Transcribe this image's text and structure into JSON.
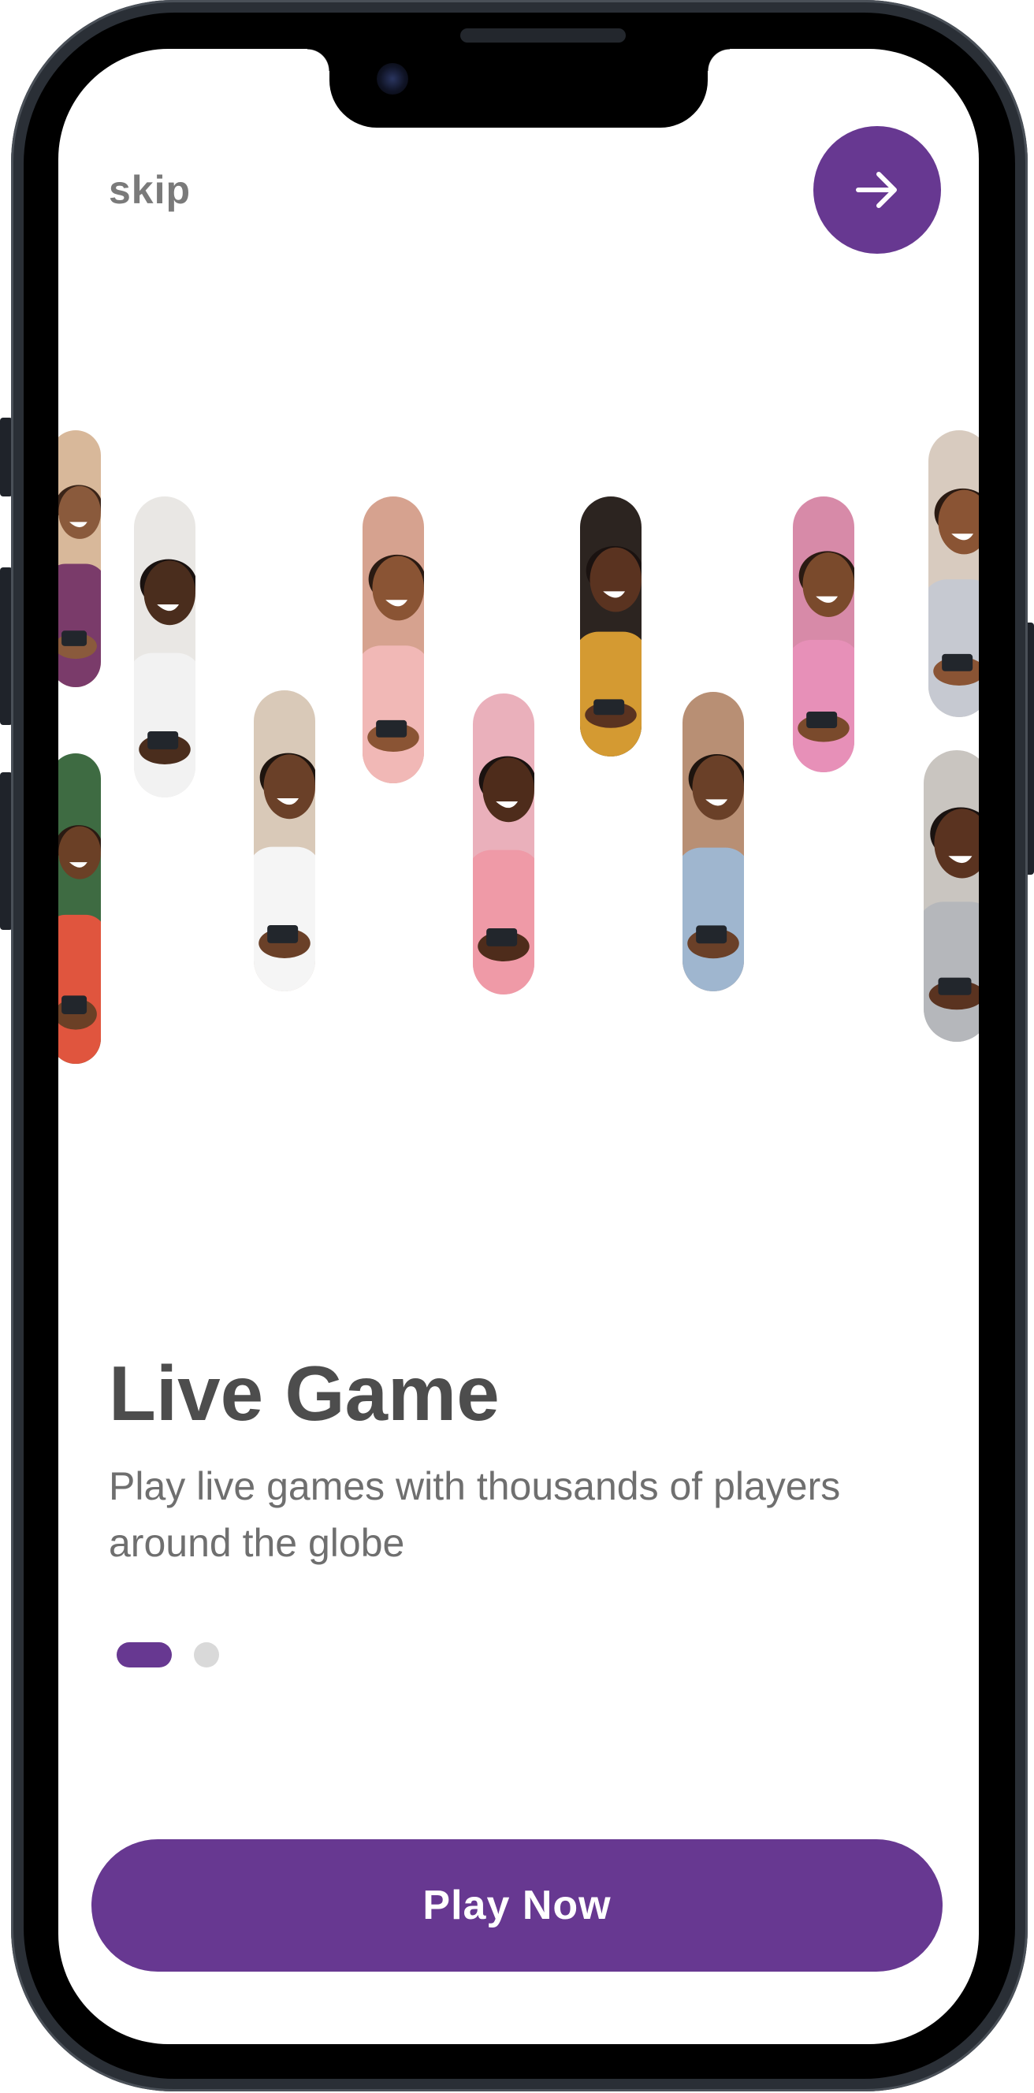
{
  "header": {
    "skip_label": "skip",
    "next_icon": "arrow-right-icon"
  },
  "onboarding": {
    "title": "Live Game",
    "description": "Play live games with thousands of players around the globe",
    "page_indicator": {
      "current": 1,
      "total": 2
    }
  },
  "cta": {
    "label": "Play Now"
  },
  "colors": {
    "accent": "#673891",
    "title": "#4d4d4d",
    "body": "#6f6f6f",
    "skip": "#7a7a7a",
    "dot_inactive": "#d9d9d9"
  },
  "photos": [
    {
      "name": "photo-woman-smiling-left-top"
    },
    {
      "name": "photo-woman-phone-left-bottom"
    },
    {
      "name": "photo-man-laughing-phone"
    },
    {
      "name": "photo-woman-phone-reading"
    },
    {
      "name": "photo-woman-laughing-phone"
    },
    {
      "name": "photo-man-laughing-pink"
    },
    {
      "name": "photo-woman-yellow-top"
    },
    {
      "name": "photo-man-glasses-phone"
    },
    {
      "name": "photo-woman-pink-jacket"
    },
    {
      "name": "photo-woman-glasses-right-top"
    },
    {
      "name": "photo-man-glasses-right-bottom"
    }
  ]
}
